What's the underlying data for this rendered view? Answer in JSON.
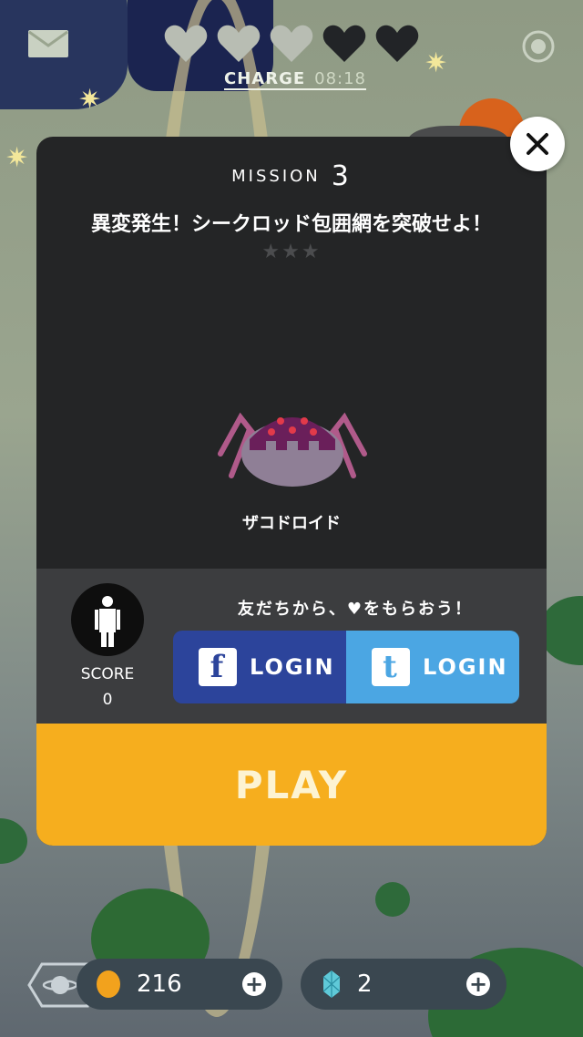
{
  "header": {
    "hearts": [
      {
        "state": "empty",
        "icon": "heart-icon"
      },
      {
        "state": "empty",
        "icon": "heart-icon"
      },
      {
        "state": "empty",
        "icon": "heart-icon"
      },
      {
        "state": "full",
        "icon": "heart-icon"
      },
      {
        "state": "full",
        "icon": "heart-icon"
      }
    ],
    "charge_label": "CHARGE",
    "charge_timer": "08:18"
  },
  "mission": {
    "label": "MISSION",
    "number": "3",
    "title": "異変発生！シークロッド包囲網を突破せよ！",
    "stars": "★★★",
    "enemy_name": "ザコドロイド"
  },
  "score": {
    "label": "SCORE",
    "value": "0"
  },
  "social": {
    "prompt": "友だちから、♥をもらおう！",
    "facebook_logo": "f",
    "facebook_label": "LOGIN",
    "twitter_logo": "t",
    "twitter_label": "LOGIN"
  },
  "play_label": "PLAY",
  "currency": {
    "coins": "216",
    "gems": "2"
  },
  "colors": {
    "panel": "#242526",
    "play": "#f6ae1e",
    "facebook": "#2c449b",
    "twitter": "#4ba6e3"
  }
}
